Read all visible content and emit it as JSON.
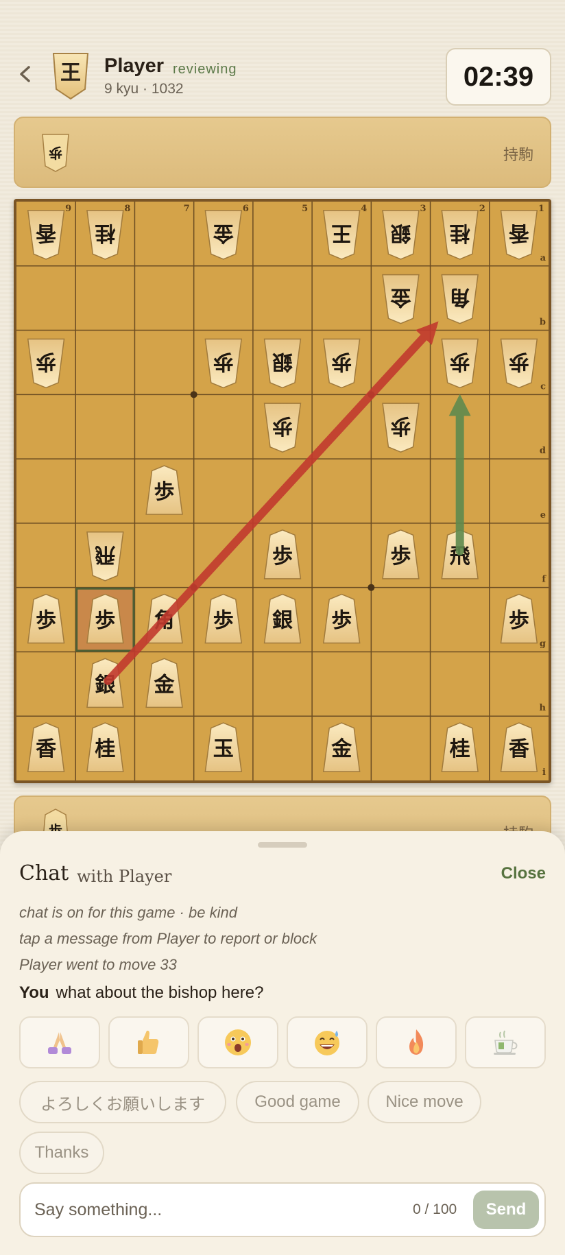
{
  "header": {
    "back_icon": "chevron-left-icon",
    "avatar_char": "王",
    "player_name": "Player",
    "status": "reviewing",
    "rank": "9 kyu · 1032",
    "clock": "02:39"
  },
  "top_hand": {
    "label": "持駒",
    "pieces": [
      "歩"
    ]
  },
  "bottom_hand": {
    "label": "持駒",
    "pieces": [
      "歩"
    ]
  },
  "board": {
    "file_labels": [
      "9",
      "8",
      "7",
      "6",
      "5",
      "4",
      "3",
      "2",
      "1"
    ],
    "rank_labels": [
      "a",
      "b",
      "c",
      "d",
      "e",
      "f",
      "g",
      "h",
      "i"
    ],
    "pieces": [
      {
        "file": 9,
        "rank": 1,
        "kanji": "香",
        "side": "gote"
      },
      {
        "file": 8,
        "rank": 1,
        "kanji": "桂",
        "side": "gote"
      },
      {
        "file": 6,
        "rank": 1,
        "kanji": "金",
        "side": "gote"
      },
      {
        "file": 4,
        "rank": 1,
        "kanji": "王",
        "side": "gote"
      },
      {
        "file": 3,
        "rank": 1,
        "kanji": "銀",
        "side": "gote"
      },
      {
        "file": 2,
        "rank": 1,
        "kanji": "桂",
        "side": "gote"
      },
      {
        "file": 1,
        "rank": 1,
        "kanji": "香",
        "side": "gote"
      },
      {
        "file": 3,
        "rank": 2,
        "kanji": "金",
        "side": "gote"
      },
      {
        "file": 2,
        "rank": 2,
        "kanji": "角",
        "side": "gote"
      },
      {
        "file": 9,
        "rank": 3,
        "kanji": "歩",
        "side": "gote"
      },
      {
        "file": 6,
        "rank": 3,
        "kanji": "歩",
        "side": "gote"
      },
      {
        "file": 5,
        "rank": 3,
        "kanji": "銀",
        "side": "gote"
      },
      {
        "file": 4,
        "rank": 3,
        "kanji": "歩",
        "side": "gote"
      },
      {
        "file": 2,
        "rank": 3,
        "kanji": "歩",
        "side": "gote"
      },
      {
        "file": 1,
        "rank": 3,
        "kanji": "歩",
        "side": "gote"
      },
      {
        "file": 5,
        "rank": 4,
        "kanji": "歩",
        "side": "gote"
      },
      {
        "file": 3,
        "rank": 4,
        "kanji": "歩",
        "side": "gote"
      },
      {
        "file": 7,
        "rank": 5,
        "kanji": "歩",
        "side": "sente"
      },
      {
        "file": 8,
        "rank": 6,
        "kanji": "飛",
        "side": "gote"
      },
      {
        "file": 5,
        "rank": 6,
        "kanji": "歩",
        "side": "sente"
      },
      {
        "file": 3,
        "rank": 6,
        "kanji": "歩",
        "side": "sente"
      },
      {
        "file": 2,
        "rank": 6,
        "kanji": "飛",
        "side": "sente"
      },
      {
        "file": 9,
        "rank": 7,
        "kanji": "歩",
        "side": "sente"
      },
      {
        "file": 8,
        "rank": 7,
        "kanji": "歩",
        "side": "sente"
      },
      {
        "file": 7,
        "rank": 7,
        "kanji": "角",
        "side": "sente"
      },
      {
        "file": 6,
        "rank": 7,
        "kanji": "歩",
        "side": "sente"
      },
      {
        "file": 5,
        "rank": 7,
        "kanji": "銀",
        "side": "sente"
      },
      {
        "file": 4,
        "rank": 7,
        "kanji": "歩",
        "side": "sente"
      },
      {
        "file": 1,
        "rank": 7,
        "kanji": "歩",
        "side": "sente"
      },
      {
        "file": 8,
        "rank": 8,
        "kanji": "銀",
        "side": "sente"
      },
      {
        "file": 7,
        "rank": 8,
        "kanji": "金",
        "side": "sente"
      },
      {
        "file": 9,
        "rank": 9,
        "kanji": "香",
        "side": "sente"
      },
      {
        "file": 8,
        "rank": 9,
        "kanji": "桂",
        "side": "sente"
      },
      {
        "file": 6,
        "rank": 9,
        "kanji": "玉",
        "side": "sente"
      },
      {
        "file": 4,
        "rank": 9,
        "kanji": "金",
        "side": "sente"
      },
      {
        "file": 2,
        "rank": 9,
        "kanji": "桂",
        "side": "sente"
      },
      {
        "file": 1,
        "rank": 9,
        "kanji": "香",
        "side": "sente"
      }
    ],
    "highlight": {
      "file": 8,
      "rank": 7
    },
    "arrows": [
      {
        "from": {
          "file": 8,
          "rank": 8
        },
        "to": {
          "file": 2,
          "rank": 2
        },
        "color": "#c23a2e"
      },
      {
        "from": {
          "file": 2,
          "rank": 6
        },
        "to": {
          "file": 2,
          "rank": 3
        },
        "color": "#5f8a4e"
      }
    ]
  },
  "chat": {
    "title": "Chat",
    "subtitle": "with Player",
    "close_label": "Close",
    "system_messages": [
      "chat is on for this game · be kind",
      "tap a message from Player to report or block",
      "Player went to move 33"
    ],
    "message": {
      "sender": "You",
      "text": "what about the bishop here?"
    },
    "emoji_reactions": [
      "folded-hands-icon",
      "thumbs-up-icon",
      "surprised-face-icon",
      "sweat-smile-icon",
      "fire-icon",
      "tea-cup-icon"
    ],
    "quick_replies": [
      "よろしくお願いします",
      "Good game",
      "Nice move",
      "Thanks"
    ],
    "input": {
      "placeholder": "Say something...",
      "value": "",
      "counter": "0 / 100"
    },
    "send_label": "Send"
  },
  "colors": {
    "board": "#d4a349",
    "accent_green": "#57733f",
    "arrow_red": "#c23a2e",
    "arrow_green": "#5f8a4e"
  }
}
